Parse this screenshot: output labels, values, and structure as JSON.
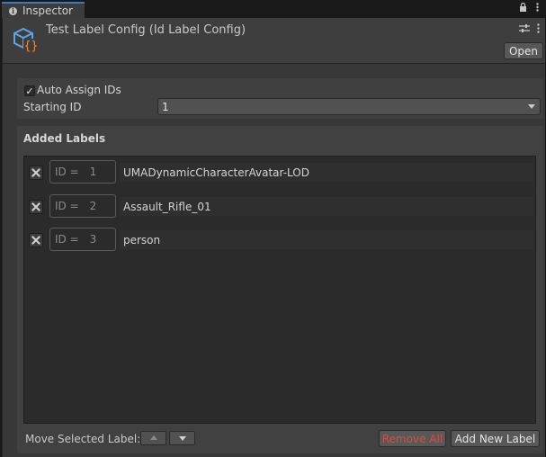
{
  "window": {
    "tab_title": "Inspector",
    "tab_tools": [
      "lock-icon",
      "menu-icon"
    ]
  },
  "asset": {
    "title": "Test Label Config (Id Label Config)",
    "open_label": "Open",
    "icon_colors": {
      "cube": "#5aa6e8",
      "braces": "#f08a3c"
    }
  },
  "settings": {
    "auto_assign_label": "Auto Assign IDs",
    "auto_assign_checked": true,
    "starting_id_label": "Starting ID",
    "starting_id_value": "1"
  },
  "labels": {
    "section_title": "Added Labels",
    "id_prefix": "ID =",
    "items": [
      {
        "id": "1",
        "name": "UMADynamicCharacterAvatar-LOD"
      },
      {
        "id": "2",
        "name": "Assault_Rifle_01"
      },
      {
        "id": "3",
        "name": "person"
      }
    ]
  },
  "footer": {
    "move_label": "Move Selected Label:",
    "remove_all_label": "Remove All",
    "add_new_label": "Add New Label",
    "remove_color": "#e04a3a"
  }
}
